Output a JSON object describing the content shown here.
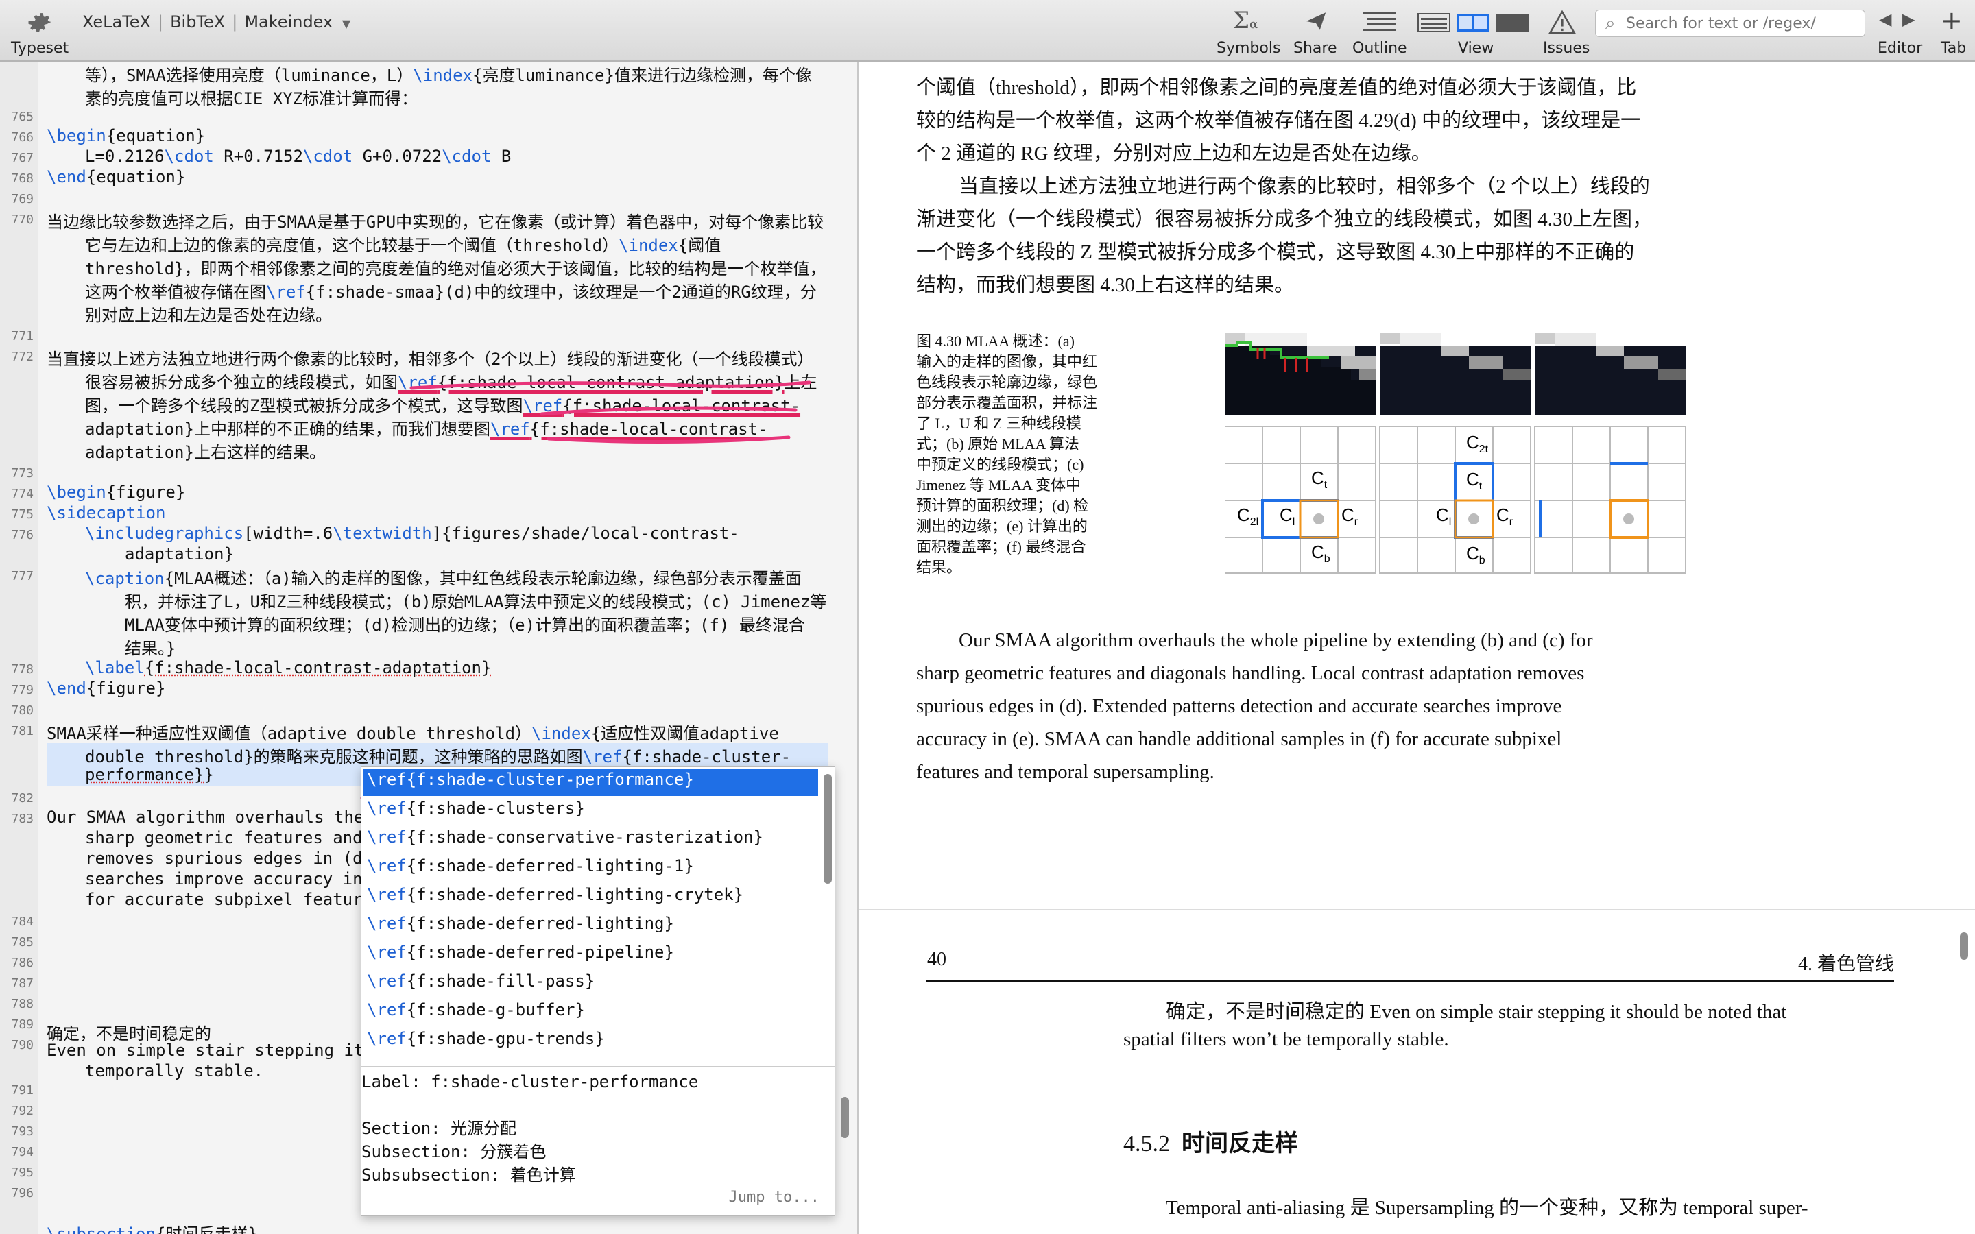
{
  "toolbar": {
    "typeset_label": "Typeset",
    "engine_options": [
      "XeLaTeX",
      "BibTeX",
      "Makeindex"
    ],
    "symbols_label": "Symbols",
    "share_label": "Share",
    "outline_label": "Outline",
    "view_label": "View",
    "issues_label": "Issues",
    "search_placeholder": "Search for text or /regex/",
    "editor_label": "Editor",
    "tab_label": "Tab"
  },
  "editor": {
    "line_numbers": [
      "765",
      "766",
      "767",
      "768",
      "769",
      "770",
      "771",
      "772",
      "773",
      "774",
      "775",
      "776",
      "777",
      "778",
      "779",
      "780",
      "781",
      "782",
      "783",
      "784",
      "785",
      "786",
      "787",
      "788",
      "789",
      "790",
      "791",
      "792",
      "793",
      "794",
      "795",
      "796"
    ],
    "lines": {
      "l0a": "等），SMAA选择使用亮度（luminance，L）",
      "l0b": "\\index",
      "l0c": "{亮度luminance}值来进行边缘检测，每个像",
      "l0d": "素的亮度值可以根据CIE XYZ标准计算而得：",
      "l766": "\\begin",
      "l766b": "{equation}",
      "l767a": "L=0.2126",
      "l767b": "\\cdot",
      "l767c": " R+0.7152",
      "l767d": "\\cdot",
      "l767e": " G+0.0722",
      "l767f": "\\cdot",
      "l767g": " B",
      "l768": "\\end",
      "l768b": "{equation}",
      "l770a": "当边缘比较参数选择之后，由于SMAA是基于GPU中实现的，它在像素（或计算）着色器中，对每个像素比较",
      "l770b": "它与左边和上边的像素的亮度值，这个比较基于一个阈值（threshold）",
      "l770b2": "\\index",
      "l770b3": "{阈值",
      "l770c": "threshold}，即两个相邻像素之间的亮度差值的绝对值必须大于该阈值，比较的结构是一个枚举值，",
      "l770d": "这两个枚举值被存储在图",
      "l770d2": "\\ref",
      "l770d3": "{f:shade-smaa}(d)中的纹理中，该纹理是一个2通道的RG纹理，分",
      "l770e": "别对应上边和左边是否处在边缘。",
      "l772a": "当直接以上述方法独立地进行两个像素的比较时，相邻多个（2个以上）线段的渐进变化（一个线段模式）",
      "l772b": "很容易被拆分成多个独立的线段模式，如图",
      "l772b2": "\\ref",
      "l772b3": "{f:shade-local-contrast-adaptation}",
      "l772b4": "上左",
      "l772c": "图，一个跨多个线段的Z型模式被拆分成多个模式，这导致图",
      "l772c2": "\\ref",
      "l772c3": "{f:shade-local-contrast-",
      "l772d": "adaptation}上中那样的不正确的结果，而我们想要图",
      "l772d2": "\\ref",
      "l772d3": "{f:shade-local-contrast-",
      "l772e": "adaptation}上右这样的结果。",
      "l774": "\\begin",
      "l774b": "{figure}",
      "l775": "\\sidecaption",
      "l776a": "\\includegraphics",
      "l776b": "[width=.6",
      "l776c": "\\textwidth",
      "l776d": "]{figures/shade/local-contrast-",
      "l776e": "adaptation}",
      "l777a": "\\caption",
      "l777b": "{MLAA概述：（a)输入的走样的图像，其中红色线段表示轮廓边缘，绿色部分表示覆盖面",
      "l777c": "积，并标注了L，U和Z三种线段模式；(b)原始MLAA算法中预定义的线段模式；(c) Jimenez等",
      "l777d": "MLAA变体中预计算的面积纹理；(d)检测出的边缘；（e)计算出的面积覆盖率；(f) 最终混合",
      "l777e": "结果。}",
      "l778a": "\\label",
      "l778b": "{f:shade-local-contrast-adaptation}",
      "l779": "\\end",
      "l779b": "{figure}",
      "l781a": "SMAA采样一种适应性双阈值（adaptive double threshold）",
      "l781b": "\\index",
      "l781c": "{适应性双阈值adaptive",
      "l781d": "double threshold}的策略来克服这种问题，这种策略的思路如图",
      "l781e": "\\ref",
      "l781f": "{f:shade-cluster-",
      "l781g": "performance}",
      "l781h": "}",
      "l783a": "Our SMAA algorithm overhauls the",
      "l783b": "sharp geometric features and",
      "l783c": "removes spurious edges in (d",
      "l783d": "searches improve accuracy in",
      "l783e": "for accurate subpixel featur",
      "l789": "确定，不是时间稳定的",
      "l790a": "Even on simple stair stepping it",
      "l790b": "temporally stable.",
      "l797a": "\\subsection",
      "l797b": "{时间反走样}"
    }
  },
  "completion": {
    "items": [
      {
        "cmd": "\\ref",
        "arg": "{f:shade-cluster-performance}"
      },
      {
        "cmd": "\\ref",
        "arg": "{f:shade-clusters}"
      },
      {
        "cmd": "\\ref",
        "arg": "{f:shade-conservative-rasterization}"
      },
      {
        "cmd": "\\ref",
        "arg": "{f:shade-deferred-lighting-1}"
      },
      {
        "cmd": "\\ref",
        "arg": "{f:shade-deferred-lighting-crytek}"
      },
      {
        "cmd": "\\ref",
        "arg": "{f:shade-deferred-lighting}"
      },
      {
        "cmd": "\\ref",
        "arg": "{f:shade-deferred-pipeline}"
      },
      {
        "cmd": "\\ref",
        "arg": "{f:shade-fill-pass}"
      },
      {
        "cmd": "\\ref",
        "arg": "{f:shade-g-buffer}"
      },
      {
        "cmd": "\\ref",
        "arg": "{f:shade-gpu-trends}"
      }
    ],
    "info_label": "Label: f:shade-cluster-performance",
    "info_section": "Section: 光源分配",
    "info_subsection": "Subsection: 分簇着色",
    "info_subsubsection": "Subsubsection: 着色计算",
    "jump_label": "Jump to..."
  },
  "pdf": {
    "top_lines": [
      "个阈值（threshold），即两个相邻像素之间的亮度差值的绝对值必须大于该阈值，比",
      "较的结构是一个枚举值，这两个枚举值被存储在图 4.29(d) 中的纹理中，该纹理是一",
      "个 2 通道的 RG 纹理，分别对应上边和左边是否处在边缘。",
      "当直接以上述方法独立地进行两个像素的比较时，相邻多个（2 个以上）线段的",
      "渐进变化（一个线段模式）很容易被拆分成多个独立的线段模式，如图 4.30上左图，",
      "一个跨多个线段的 Z 型模式被拆分成多个模式，这导致图 4.30上中那样的不正确的",
      "结构，而我们想要图 4.30上右这样的结果。"
    ],
    "caption_lines": [
      "图 4.30 MLAA 概述：(a)",
      "输入的走样的图像，其中红",
      "色线段表示轮廓边缘，绿色",
      "部分表示覆盖面积，并标注",
      "了 L，U 和 Z 三种线段模",
      "式；(b) 原始 MLAA 算法",
      "中预定义的线段模式；(c)",
      "Jimenez 等 MLAA 变体中",
      "预计算的面积纹理；(d) 检",
      "测出的边缘；(e) 计算出的",
      "面积覆盖率；(f) 最终混合",
      "结果。"
    ],
    "grid_labels": {
      "ct": "C",
      "ct_sub": "t",
      "c2l": "C",
      "c2l_sub": "2l",
      "cl": "C",
      "cl_sub": "l",
      "cr": "C",
      "cr_sub": "r",
      "cb": "C",
      "cb_sub": "b",
      "c2t": "C",
      "c2t_sub": "2t"
    },
    "para2_lines": [
      "Our SMAA algorithm overhauls the whole pipeline by extending (b) and (c) for",
      "sharp geometric features and diagonals handling. Local contrast adaptation removes",
      "spurious edges in (d). Extended patterns detection and accurate searches improve",
      "accuracy in (e). SMAA can handle additional samples in (f) for accurate subpixel",
      "features and temporal supersampling."
    ],
    "page_number": "40",
    "chapter_header": "4. 着色管线",
    "page2_lines": [
      "确定，不是时间稳定的 Even on simple stair stepping it should be noted that",
      "spatial filters won’t be temporally stable."
    ],
    "section_number": "4.5.2",
    "section_title": "时间反走样",
    "cut_line": "Temporal anti-aliasing 是 Supersampling 的一个变种，又称为 temporal super-"
  }
}
